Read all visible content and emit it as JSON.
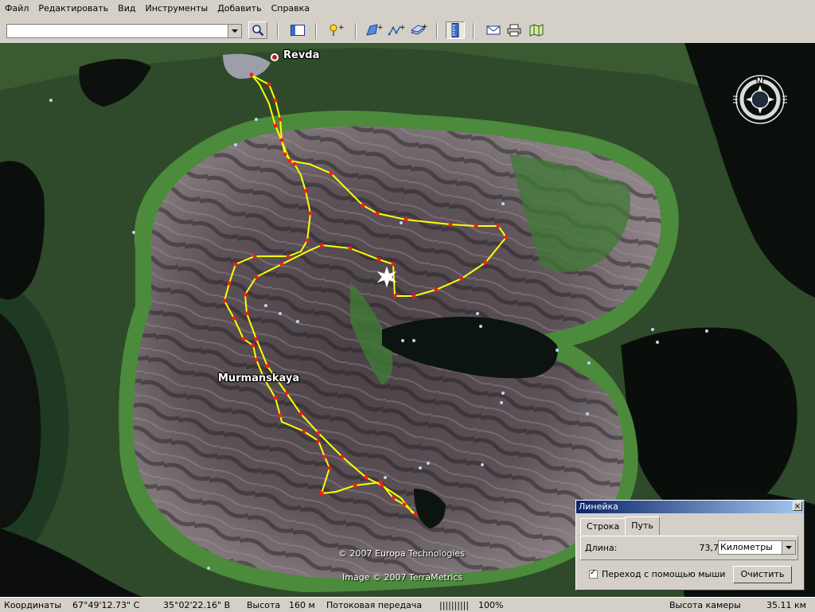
{
  "menu": {
    "items": [
      "Файл",
      "Редактировать",
      "Вид",
      "Инструменты",
      "Добавить",
      "Справка"
    ]
  },
  "toolbar": {
    "search_value": "",
    "buttons": [
      "search-icon",
      "sidebar-toggle-icon",
      "placemark-icon",
      "polygon-icon",
      "path-icon",
      "image-overlay-icon",
      "ruler-icon",
      "email-icon",
      "print-icon",
      "map-icon"
    ]
  },
  "map": {
    "places": {
      "revda": "Revda",
      "murmanskaya": "Murmanskaya"
    },
    "copyright_1": "© 2007 Europa Technologies",
    "copyright_2": "Image © 2007 TerraMetrics",
    "compass_north": "N",
    "path_color": "#ffff00",
    "vertex_color": "#ff1a1a"
  },
  "ruler": {
    "title": "Линейка",
    "close": "×",
    "tabs": [
      "Строка",
      "Путь"
    ],
    "active_tab": "Путь",
    "length_label": "Длина:",
    "length_value": "73,72",
    "unit": "Километры",
    "mouse_nav_label": "Переход с помощью мыши",
    "mouse_nav_checked": true,
    "clear_label": "Очистить"
  },
  "status": {
    "coords_label": "Координаты",
    "lat": "67°49'12.73\" С",
    "lon": "35°02'22.16\" В",
    "elevation_label": "Высота",
    "elevation": "160 м",
    "streaming_label": "Потоковая передача",
    "streaming_bar": "||||||||||",
    "streaming_percent": "100%",
    "camera_label": "Высота камеры",
    "camera_alt": "35.11 км"
  }
}
